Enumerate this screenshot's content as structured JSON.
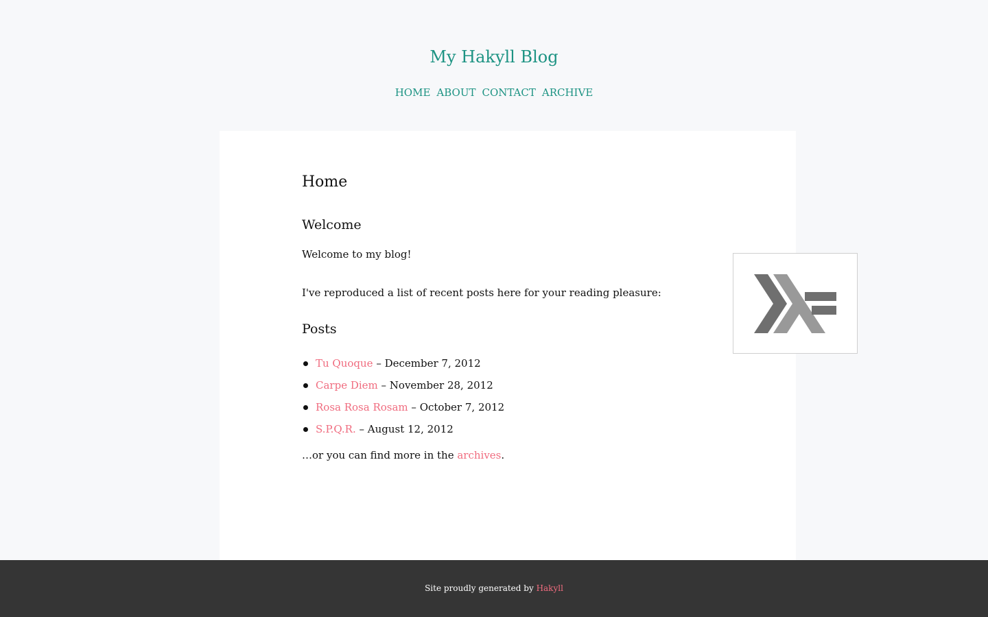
{
  "header": {
    "site_title": "My Hakyll Blog",
    "nav": [
      "Home",
      "About",
      "Contact",
      "Archive"
    ]
  },
  "main": {
    "page_title": "Home",
    "welcome_heading": "Welcome",
    "welcome_text": "Welcome to my blog!",
    "intro_text": "I've reproduced a list of recent posts here for your reading pleasure:",
    "posts_heading": "Posts",
    "posts": [
      {
        "title": "Tu Quoque",
        "date": " – December 7, 2012"
      },
      {
        "title": "Carpe Diem",
        "date": " – November 28, 2012"
      },
      {
        "title": "Rosa Rosa Rosam",
        "date": " – October 7, 2012"
      },
      {
        "title": "S.P.Q.R.",
        "date": " – August 12, 2012"
      }
    ],
    "more_prefix": "…or you can find more in the ",
    "more_link": "archives",
    "more_suffix": ".",
    "logo_icon": "haskell-logo-icon"
  },
  "footer": {
    "prefix": "Site proudly generated by ",
    "link": "Hakyll"
  },
  "colors": {
    "accent": "#1d9383",
    "link": "#f06c7f",
    "footer_bg": "#353535",
    "page_bg": "#f7f8fa"
  }
}
